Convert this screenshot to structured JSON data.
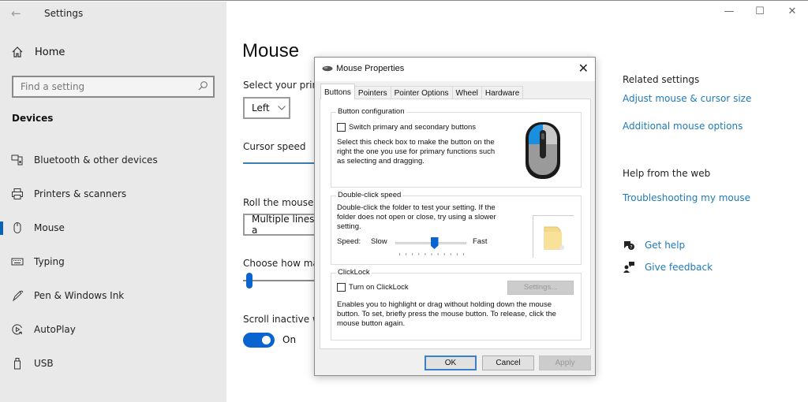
{
  "window": {
    "title": "Settings",
    "controls": {
      "minimize": "—",
      "maximize": "☐",
      "close": "✕"
    }
  },
  "sidebar": {
    "home_label": "Home",
    "search_placeholder": "Find a setting",
    "section_title": "Devices",
    "items": [
      {
        "label": "Bluetooth & other devices",
        "icon": "bluetooth-devices-icon",
        "active": false
      },
      {
        "label": "Printers & scanners",
        "icon": "printer-icon",
        "active": false
      },
      {
        "label": "Mouse",
        "icon": "mouse-icon",
        "active": true
      },
      {
        "label": "Typing",
        "icon": "keyboard-icon",
        "active": false
      },
      {
        "label": "Pen & Windows Ink",
        "icon": "pen-icon",
        "active": false
      },
      {
        "label": "AutoPlay",
        "icon": "autoplay-icon",
        "active": false
      },
      {
        "label": "USB",
        "icon": "usb-icon",
        "active": false
      }
    ]
  },
  "main": {
    "title": "Mouse",
    "primary_button_label": "Select your prim",
    "primary_button_value": "Left",
    "cursor_speed_label": "Cursor speed",
    "roll_label": "Roll the mouse w",
    "roll_value": "Multiple lines a",
    "lines_label": "Choose how ma",
    "scroll_inactive_label": "Scroll inactive wi",
    "scroll_inactive_state": "On"
  },
  "related": {
    "heading": "Related settings",
    "links": [
      "Adjust mouse & cursor size",
      "Additional mouse options"
    ],
    "web_heading": "Help from the web",
    "web_links": [
      "Troubleshooting my mouse"
    ],
    "get_help": "Get help",
    "give_feedback": "Give feedback",
    "link_color": "#1f7ab8"
  },
  "dialog": {
    "title": "Mouse Properties",
    "close": "✕",
    "tabs": [
      "Buttons",
      "Pointers",
      "Pointer Options",
      "Wheel",
      "Hardware"
    ],
    "active_tab": "Buttons",
    "button_config": {
      "title": "Button configuration",
      "checkbox_label": "Switch primary and secondary buttons",
      "checked": false,
      "description_lines": [
        "Select this check box to make the button on the",
        "right the one you use for primary functions such",
        "as selecting and dragging."
      ]
    },
    "double_click": {
      "title": "Double-click speed",
      "description_lines": [
        "Double-click the folder to test your setting. If the",
        "folder does not open or close, try using a slower",
        "setting."
      ],
      "speed_label": "Speed:",
      "slow_label": "Slow",
      "fast_label": "Fast",
      "slider_value": 0.55,
      "tick_count": 11
    },
    "clicklock": {
      "title": "ClickLock",
      "checkbox_label": "Turn on ClickLock",
      "checked": false,
      "settings_button": "Settings...",
      "description_lines": [
        "Enables you to highlight or drag without holding down the mouse",
        "button. To set, briefly press the mouse button. To release, click the",
        "mouse button again."
      ]
    },
    "buttons": {
      "ok": "OK",
      "cancel": "Cancel",
      "apply": "Apply"
    }
  }
}
